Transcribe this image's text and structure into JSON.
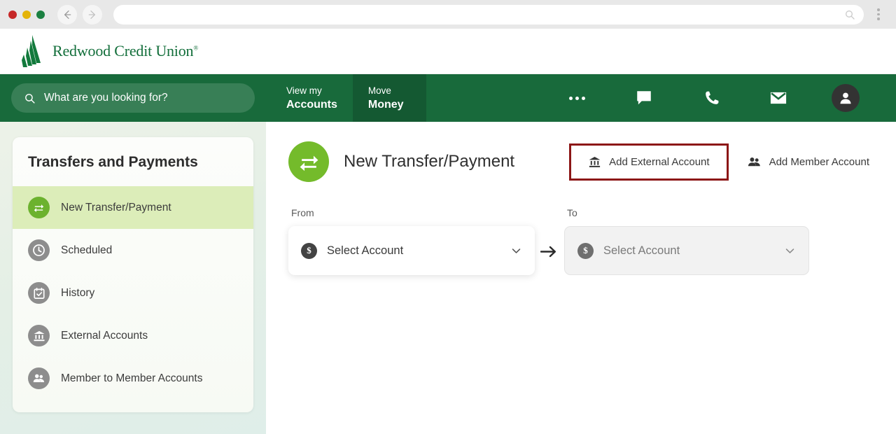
{
  "browser": {
    "url_value": "",
    "url_placeholder": "",
    "back_icon": "back-arrow-icon",
    "forward_icon": "forward-arrow-icon",
    "search_icon": "search-icon",
    "menu_icon": "kebab-menu-icon"
  },
  "header": {
    "brand_name": "Redwood Credit Union",
    "brand_trademark": "®",
    "logo_color": "#127a3c"
  },
  "nav": {
    "search_placeholder": "What are you looking for?",
    "tabs": [
      {
        "top": "View my",
        "bottom": "Accounts",
        "active": false
      },
      {
        "top": "Move",
        "bottom": "Money",
        "active": true
      }
    ],
    "icons": [
      {
        "name": "more-ellipsis-icon",
        "label": "More"
      },
      {
        "name": "chat-bubble-icon",
        "label": "Chat"
      },
      {
        "name": "phone-icon",
        "label": "Call"
      },
      {
        "name": "envelope-icon",
        "label": "Messages"
      },
      {
        "name": "user-avatar-icon",
        "label": "Profile"
      }
    ],
    "bar_color": "#186a3b",
    "active_tab_color": "#145932"
  },
  "sidebar": {
    "title": "Transfers and Payments",
    "items": [
      {
        "label": "New Transfer/Payment",
        "icon": "transfer-arrows-icon",
        "active": true
      },
      {
        "label": "Scheduled",
        "icon": "clock-icon",
        "active": false
      },
      {
        "label": "History",
        "icon": "calendar-check-icon",
        "active": false
      },
      {
        "label": "External Accounts",
        "icon": "bank-icon",
        "active": false
      },
      {
        "label": "Member to Member Accounts",
        "icon": "people-icon",
        "active": false
      }
    ],
    "active_bg": "#dcedb9",
    "active_icon_color": "#6cb22e",
    "icon_color": "#8d8d8d"
  },
  "main": {
    "page_title": "New Transfer/Payment",
    "page_icon": "transfer-arrows-icon",
    "page_icon_color": "#74bb2b",
    "actions": [
      {
        "label": "Add External Account",
        "icon": "bank-icon",
        "highlighted": true
      },
      {
        "label": "Add Member Account",
        "icon": "people-icon",
        "highlighted": false
      }
    ],
    "highlight_color": "#8c1616",
    "form": {
      "from_label": "From",
      "from_value": "Select Account",
      "from_icon": "dollar-circle-icon",
      "to_label": "To",
      "to_value": "Select Account",
      "to_icon": "dollar-circle-icon",
      "direction_icon": "right-arrow-icon",
      "chevron_icon": "chevron-down-icon",
      "currency_symbol": "$"
    }
  }
}
